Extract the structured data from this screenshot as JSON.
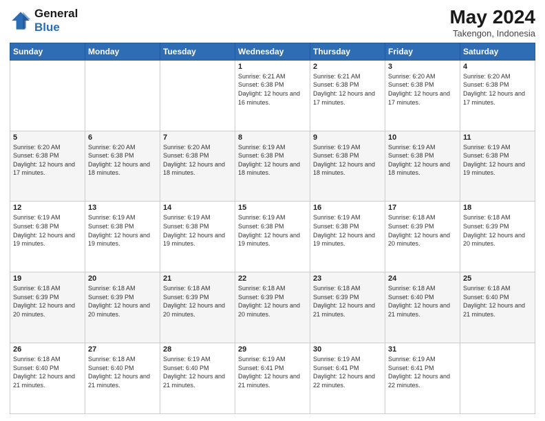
{
  "header": {
    "logo_line1": "General",
    "logo_line2": "Blue",
    "month_title": "May 2024",
    "location": "Takengon, Indonesia"
  },
  "days_of_week": [
    "Sunday",
    "Monday",
    "Tuesday",
    "Wednesday",
    "Thursday",
    "Friday",
    "Saturday"
  ],
  "weeks": [
    [
      {
        "num": "",
        "info": ""
      },
      {
        "num": "",
        "info": ""
      },
      {
        "num": "",
        "info": ""
      },
      {
        "num": "1",
        "info": "Sunrise: 6:21 AM\nSunset: 6:38 PM\nDaylight: 12 hours and 16 minutes."
      },
      {
        "num": "2",
        "info": "Sunrise: 6:21 AM\nSunset: 6:38 PM\nDaylight: 12 hours and 17 minutes."
      },
      {
        "num": "3",
        "info": "Sunrise: 6:20 AM\nSunset: 6:38 PM\nDaylight: 12 hours and 17 minutes."
      },
      {
        "num": "4",
        "info": "Sunrise: 6:20 AM\nSunset: 6:38 PM\nDaylight: 12 hours and 17 minutes."
      }
    ],
    [
      {
        "num": "5",
        "info": "Sunrise: 6:20 AM\nSunset: 6:38 PM\nDaylight: 12 hours and 17 minutes."
      },
      {
        "num": "6",
        "info": "Sunrise: 6:20 AM\nSunset: 6:38 PM\nDaylight: 12 hours and 18 minutes."
      },
      {
        "num": "7",
        "info": "Sunrise: 6:20 AM\nSunset: 6:38 PM\nDaylight: 12 hours and 18 minutes."
      },
      {
        "num": "8",
        "info": "Sunrise: 6:19 AM\nSunset: 6:38 PM\nDaylight: 12 hours and 18 minutes."
      },
      {
        "num": "9",
        "info": "Sunrise: 6:19 AM\nSunset: 6:38 PM\nDaylight: 12 hours and 18 minutes."
      },
      {
        "num": "10",
        "info": "Sunrise: 6:19 AM\nSunset: 6:38 PM\nDaylight: 12 hours and 18 minutes."
      },
      {
        "num": "11",
        "info": "Sunrise: 6:19 AM\nSunset: 6:38 PM\nDaylight: 12 hours and 19 minutes."
      }
    ],
    [
      {
        "num": "12",
        "info": "Sunrise: 6:19 AM\nSunset: 6:38 PM\nDaylight: 12 hours and 19 minutes."
      },
      {
        "num": "13",
        "info": "Sunrise: 6:19 AM\nSunset: 6:38 PM\nDaylight: 12 hours and 19 minutes."
      },
      {
        "num": "14",
        "info": "Sunrise: 6:19 AM\nSunset: 6:38 PM\nDaylight: 12 hours and 19 minutes."
      },
      {
        "num": "15",
        "info": "Sunrise: 6:19 AM\nSunset: 6:38 PM\nDaylight: 12 hours and 19 minutes."
      },
      {
        "num": "16",
        "info": "Sunrise: 6:19 AM\nSunset: 6:38 PM\nDaylight: 12 hours and 19 minutes."
      },
      {
        "num": "17",
        "info": "Sunrise: 6:18 AM\nSunset: 6:39 PM\nDaylight: 12 hours and 20 minutes."
      },
      {
        "num": "18",
        "info": "Sunrise: 6:18 AM\nSunset: 6:39 PM\nDaylight: 12 hours and 20 minutes."
      }
    ],
    [
      {
        "num": "19",
        "info": "Sunrise: 6:18 AM\nSunset: 6:39 PM\nDaylight: 12 hours and 20 minutes."
      },
      {
        "num": "20",
        "info": "Sunrise: 6:18 AM\nSunset: 6:39 PM\nDaylight: 12 hours and 20 minutes."
      },
      {
        "num": "21",
        "info": "Sunrise: 6:18 AM\nSunset: 6:39 PM\nDaylight: 12 hours and 20 minutes."
      },
      {
        "num": "22",
        "info": "Sunrise: 6:18 AM\nSunset: 6:39 PM\nDaylight: 12 hours and 20 minutes."
      },
      {
        "num": "23",
        "info": "Sunrise: 6:18 AM\nSunset: 6:39 PM\nDaylight: 12 hours and 21 minutes."
      },
      {
        "num": "24",
        "info": "Sunrise: 6:18 AM\nSunset: 6:40 PM\nDaylight: 12 hours and 21 minutes."
      },
      {
        "num": "25",
        "info": "Sunrise: 6:18 AM\nSunset: 6:40 PM\nDaylight: 12 hours and 21 minutes."
      }
    ],
    [
      {
        "num": "26",
        "info": "Sunrise: 6:18 AM\nSunset: 6:40 PM\nDaylight: 12 hours and 21 minutes."
      },
      {
        "num": "27",
        "info": "Sunrise: 6:18 AM\nSunset: 6:40 PM\nDaylight: 12 hours and 21 minutes."
      },
      {
        "num": "28",
        "info": "Sunrise: 6:19 AM\nSunset: 6:40 PM\nDaylight: 12 hours and 21 minutes."
      },
      {
        "num": "29",
        "info": "Sunrise: 6:19 AM\nSunset: 6:41 PM\nDaylight: 12 hours and 21 minutes."
      },
      {
        "num": "30",
        "info": "Sunrise: 6:19 AM\nSunset: 6:41 PM\nDaylight: 12 hours and 22 minutes."
      },
      {
        "num": "31",
        "info": "Sunrise: 6:19 AM\nSunset: 6:41 PM\nDaylight: 12 hours and 22 minutes."
      },
      {
        "num": "",
        "info": ""
      }
    ]
  ]
}
